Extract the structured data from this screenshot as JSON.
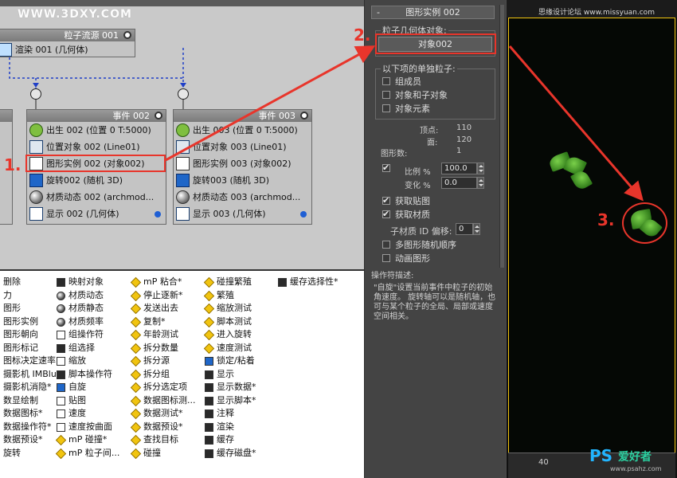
{
  "watermark": "WWW.3DXY.COM",
  "graph": {
    "source_node": {
      "title": "粒子流源 001",
      "op_label": "渲染 001 (几何体)"
    },
    "left_partial": {
      "lines": [
        "0)",
        "0)",
        "",
        "",
        "",
        ""
      ]
    },
    "event_002": {
      "title": "事件 002",
      "ops": [
        {
          "label": "出生 002 (位置 0 T:5000)",
          "icon": "birth-icon"
        },
        {
          "label": "位置对象 002 (Line01)",
          "icon": "position-object-icon"
        },
        {
          "label": "图形实例 002 (对象002)",
          "icon": "shape-instance-icon"
        },
        {
          "label": "旋转002 (随机 3D)",
          "icon": "rotation-icon"
        },
        {
          "label": "材质动态 002 (archmod...",
          "icon": "material-dynamic-icon"
        },
        {
          "label": "显示 002 (几何体)",
          "icon": "display-icon"
        }
      ]
    },
    "event_003": {
      "title": "事件 003",
      "ops": [
        {
          "label": "出生 003 (位置 0 T:5000)",
          "icon": "birth-icon"
        },
        {
          "label": "位置对象 003 (Line01)",
          "icon": "position-object-icon"
        },
        {
          "label": "图形实例 003 (对象002)",
          "icon": "shape-instance-icon"
        },
        {
          "label": "旋转003 (随机 3D)",
          "icon": "rotation-icon"
        },
        {
          "label": "材质动态 003 (archmod...",
          "icon": "material-dynamic-icon"
        },
        {
          "label": "显示 003 (几何体)",
          "icon": "display-icon"
        }
      ]
    }
  },
  "rollout": {
    "header": "图形实例 002",
    "minus": "-",
    "group1_label": "粒子几何体对象:",
    "object_button": "对象002",
    "group2_label": "以下项的单独粒子:",
    "checks": [
      {
        "label": "组成员",
        "checked": false
      },
      {
        "label": "对象和子对象",
        "checked": false
      },
      {
        "label": "对象元素",
        "checked": false
      }
    ],
    "vertices_label": "顶点:",
    "vertices_value": "110",
    "faces_label": "面:",
    "faces_value": "120",
    "shapes_label": "图形数:",
    "shapes_value": "1",
    "scale_label": "比例 %",
    "scale_value": "100.0",
    "variation_label": "变化 %",
    "variation_value": "0.0",
    "acquire_mapping": "获取贴图",
    "acquire_material": "获取材质",
    "submat_label": "子材质 ID 偏移:",
    "submat_value": "0",
    "multi_shape": "多图形随机顺序",
    "animated_shape": "动画图形",
    "desc_title": "操作符描述:",
    "desc_text": "\"自旋\"设置当前事件中粒子的初始角速度。 旋转轴可以是随机轴，也可与某个粒子的全局、局部或速度空间相关。"
  },
  "depot": {
    "col0": [
      "删除",
      "力",
      "图形",
      "图形实例",
      "图形朝向",
      "图形标记",
      "图标决定速率",
      "摄影机 IMBlur*",
      "摄影机消隐*",
      "数显绘制",
      "数据图标*",
      "数据操作符*",
      "数据预设*",
      "旋转"
    ],
    "col1": [
      "映射对象",
      "材质动态",
      "材质静态",
      "材质频率",
      "组操作符",
      "组选择",
      "缩放",
      "脚本操作符",
      "自旋",
      "贴图",
      "速度",
      "速度按曲面",
      "mP 碰撞*",
      "mP 粒子间..."
    ],
    "col2": [
      "mP 粘合*",
      "停止逐新*",
      "发送出去",
      "复制*",
      "年龄测试",
      "拆分数量",
      "拆分源",
      "拆分组",
      "拆分选定项",
      "数据图标测...",
      "数据测试*",
      "数据预设*",
      "查找目标",
      "碰撞"
    ],
    "col3": [
      "碰撞繁殖",
      "繁殖",
      "缩放测试",
      "脚本测试",
      "进入旋转",
      "速度测试",
      "锁定/粘着",
      "显示",
      "显示数据*",
      "显示脚本*",
      "注释",
      "渲染",
      "缓存",
      "缓存磁盘*"
    ],
    "col4": [
      "缓存选择性*"
    ]
  },
  "viewport": {
    "ps_credit": "思缘设计论坛  www.missyuan.com",
    "ruler_number": "40",
    "ps_logo": "PS",
    "ps_logo_sub": "爱好者",
    "ps_site": "www.psahz.com"
  },
  "annotations": {
    "step1": "1.",
    "step2": "2.",
    "step3": "3.",
    "accent_color": "#e8352b"
  }
}
